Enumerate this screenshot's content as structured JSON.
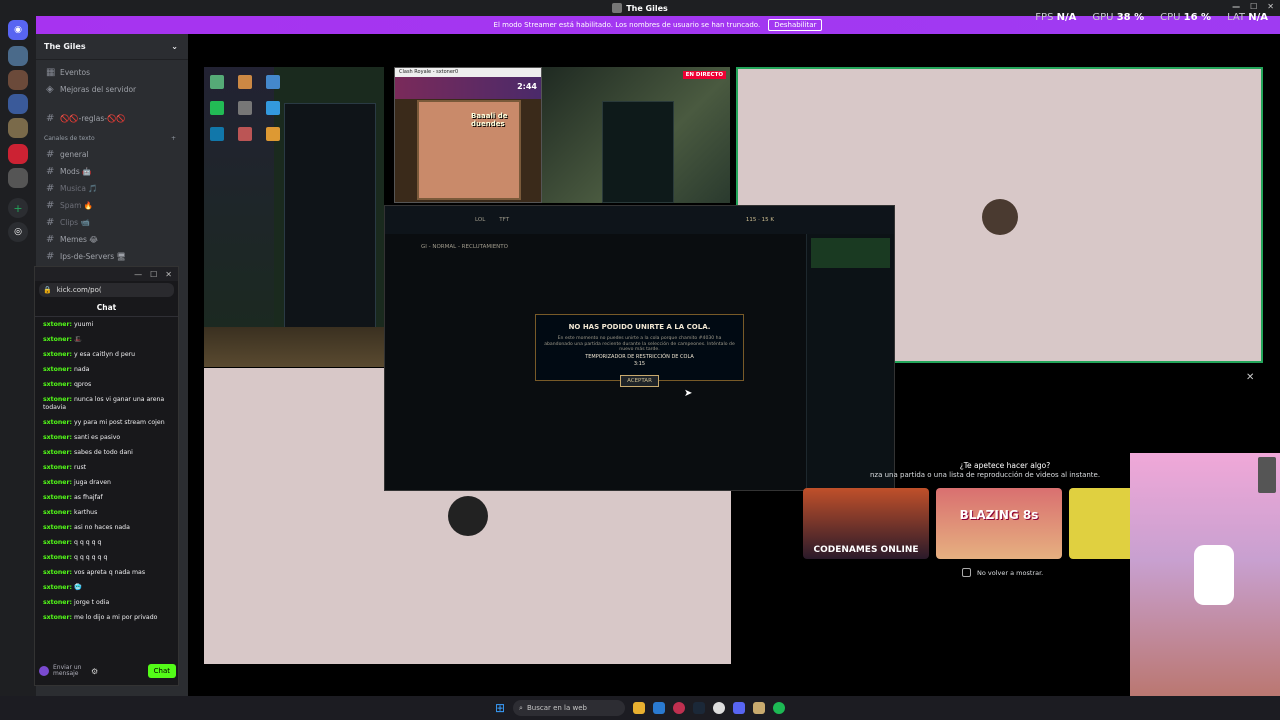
{
  "window": {
    "title": "The Giles"
  },
  "perf": [
    {
      "label": "FPS",
      "value": "N/A"
    },
    {
      "label": "GPU",
      "value": "38 %"
    },
    {
      "label": "CPU",
      "value": "16 %"
    },
    {
      "label": "LAT",
      "value": "N/A"
    }
  ],
  "streamer": {
    "message": "El modo Streamer está habilitado. Los nombres de usuario se han truncado.",
    "button": "Deshabilitar"
  },
  "server": {
    "name": "The Giles"
  },
  "channels_top": [
    {
      "icon": "calendar",
      "label": "Eventos"
    },
    {
      "icon": "boost",
      "label": "Mejoras del servidor"
    }
  ],
  "rules_channel": "🚫🚫-reglas-🚫🚫",
  "category": "Canales de texto",
  "channels": [
    {
      "label": "general"
    },
    {
      "label": "Mods 🤖"
    },
    {
      "label": "Musica 🎵"
    },
    {
      "label": "Spam 🔥"
    },
    {
      "label": "Clips 📹"
    },
    {
      "label": "Memes 😂"
    },
    {
      "label": "Ips-de-Servers 🖥"
    }
  ],
  "chat": {
    "url": "kick.com/po(",
    "title": "Chat",
    "messages": [
      {
        "user": "sxtoner:",
        "text": "yuumi"
      },
      {
        "user": "sxtoner:",
        "text": "🎩"
      },
      {
        "user": "sxtoner:",
        "text": "y esa caitlyn d peru"
      },
      {
        "user": "sxtoner:",
        "text": "nada"
      },
      {
        "user": "sxtoner:",
        "text": "qpros"
      },
      {
        "user": "sxtoner:",
        "text": "nunca los vi ganar una arena todavia"
      },
      {
        "user": "sxtoner:",
        "text": "yy para mi post stream cojen"
      },
      {
        "user": "sxtoner:",
        "text": "santi es pasivo"
      },
      {
        "user": "sxtoner:",
        "text": "sabes de todo dani"
      },
      {
        "user": "sxtoner:",
        "text": "rust"
      },
      {
        "user": "sxtoner:",
        "text": "juga draven"
      },
      {
        "user": "sxtoner:",
        "text": "as fhajfaf"
      },
      {
        "user": "sxtoner:",
        "text": "karthus"
      },
      {
        "user": "sxtoner:",
        "text": "asi no haces nada"
      },
      {
        "user": "sxtoner:",
        "text": "q q q q q"
      },
      {
        "user": "sxtoner:",
        "text": "q q q q q q"
      },
      {
        "user": "sxtoner:",
        "text": "vos apreta q nada mas"
      },
      {
        "user": "sxtoner:",
        "text": "🥶"
      },
      {
        "user": "sxtoner:",
        "text": "jorge t odia"
      },
      {
        "user": "sxtoner:",
        "text": "me lo dijo a mi por privado"
      }
    ],
    "input_placeholder": "Enviar un mensaje",
    "send": "Chat"
  },
  "stream_badge": "EN DIRECTO",
  "clash_window_title": "Clash Royale - sxtoner0",
  "clash_timer": "2:44",
  "clash_banner": "Baaali de duendes",
  "lol": {
    "tabs": [
      "LOL",
      "TFT"
    ],
    "queue": "GI - NORMAL - RECLUTAMIENTO",
    "currency": [
      "115",
      "15 K"
    ]
  },
  "modal": {
    "title": "NO HAS PODIDO UNIRTE A LA COLA.",
    "body": "En este momento no puedes unirte a la cola porque chamito #4030 ha abandonado una partida reciente durante la selección de campeones. Inténtalo de nuevo más tarde.",
    "timer_label": "TEMPORIZADOR DE RESTRICCIÓN DE COLA",
    "timer_value": "3:15",
    "button": "ACEPTAR"
  },
  "activity": {
    "title": "¿Te apetece hacer algo?",
    "subtitle": "nza una partida o una lista de reproducción de videos al instante.",
    "games": [
      "CODENAMES ONLINE",
      "BLAZING 8s"
    ],
    "checkbox": "No volver a mostrar."
  },
  "taskbar": {
    "search": "Buscar en la web"
  },
  "colors": {
    "discord_blurple": "#5865f2",
    "streamer_purple": "#a733f0",
    "kick_green": "#53fc18",
    "lol_gold": "#c8aa6e"
  }
}
